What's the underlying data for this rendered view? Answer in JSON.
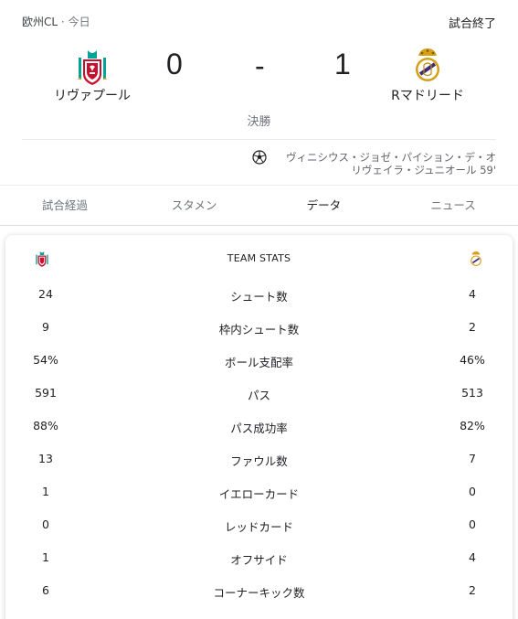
{
  "header": {
    "competition": "欧州CL",
    "separator": "·",
    "date": "今日",
    "status": "試合終了"
  },
  "match": {
    "home_team": "リヴァプール",
    "away_team": "Rマドリード",
    "home_score": "0",
    "score_separator": "-",
    "away_score": "1",
    "stage": "決勝"
  },
  "goals": [
    {
      "scorer": "ヴィニシウス・ジョゼ・パイション・デ・オリヴェイラ・ジュニオール",
      "minute": "59'"
    }
  ],
  "tabs": [
    {
      "label": "試合経過",
      "active": false
    },
    {
      "label": "スタメン",
      "active": false
    },
    {
      "label": "データ",
      "active": true
    },
    {
      "label": "ニュース",
      "active": false
    }
  ],
  "stats": {
    "title": "TEAM STATS",
    "rows": [
      {
        "label": "シュート数",
        "home": "24",
        "away": "4"
      },
      {
        "label": "枠内シュート数",
        "home": "9",
        "away": "2"
      },
      {
        "label": "ボール支配率",
        "home": "54%",
        "away": "46%"
      },
      {
        "label": "パス",
        "home": "591",
        "away": "513"
      },
      {
        "label": "パス成功率",
        "home": "88%",
        "away": "82%"
      },
      {
        "label": "ファウル数",
        "home": "13",
        "away": "7"
      },
      {
        "label": "イエローカード",
        "home": "1",
        "away": "0"
      },
      {
        "label": "レッドカード",
        "home": "0",
        "away": "0"
      },
      {
        "label": "オフサイド",
        "home": "1",
        "away": "4"
      },
      {
        "label": "コーナーキック数",
        "home": "6",
        "away": "2"
      }
    ]
  },
  "icons": {
    "home_crest": "liverpool-crest-icon",
    "away_crest": "real-madrid-crest-icon",
    "goal": "soccer-ball-icon"
  },
  "colors": {
    "liverpool_red": "#c8102e",
    "madrid_gold": "#d4a017"
  }
}
